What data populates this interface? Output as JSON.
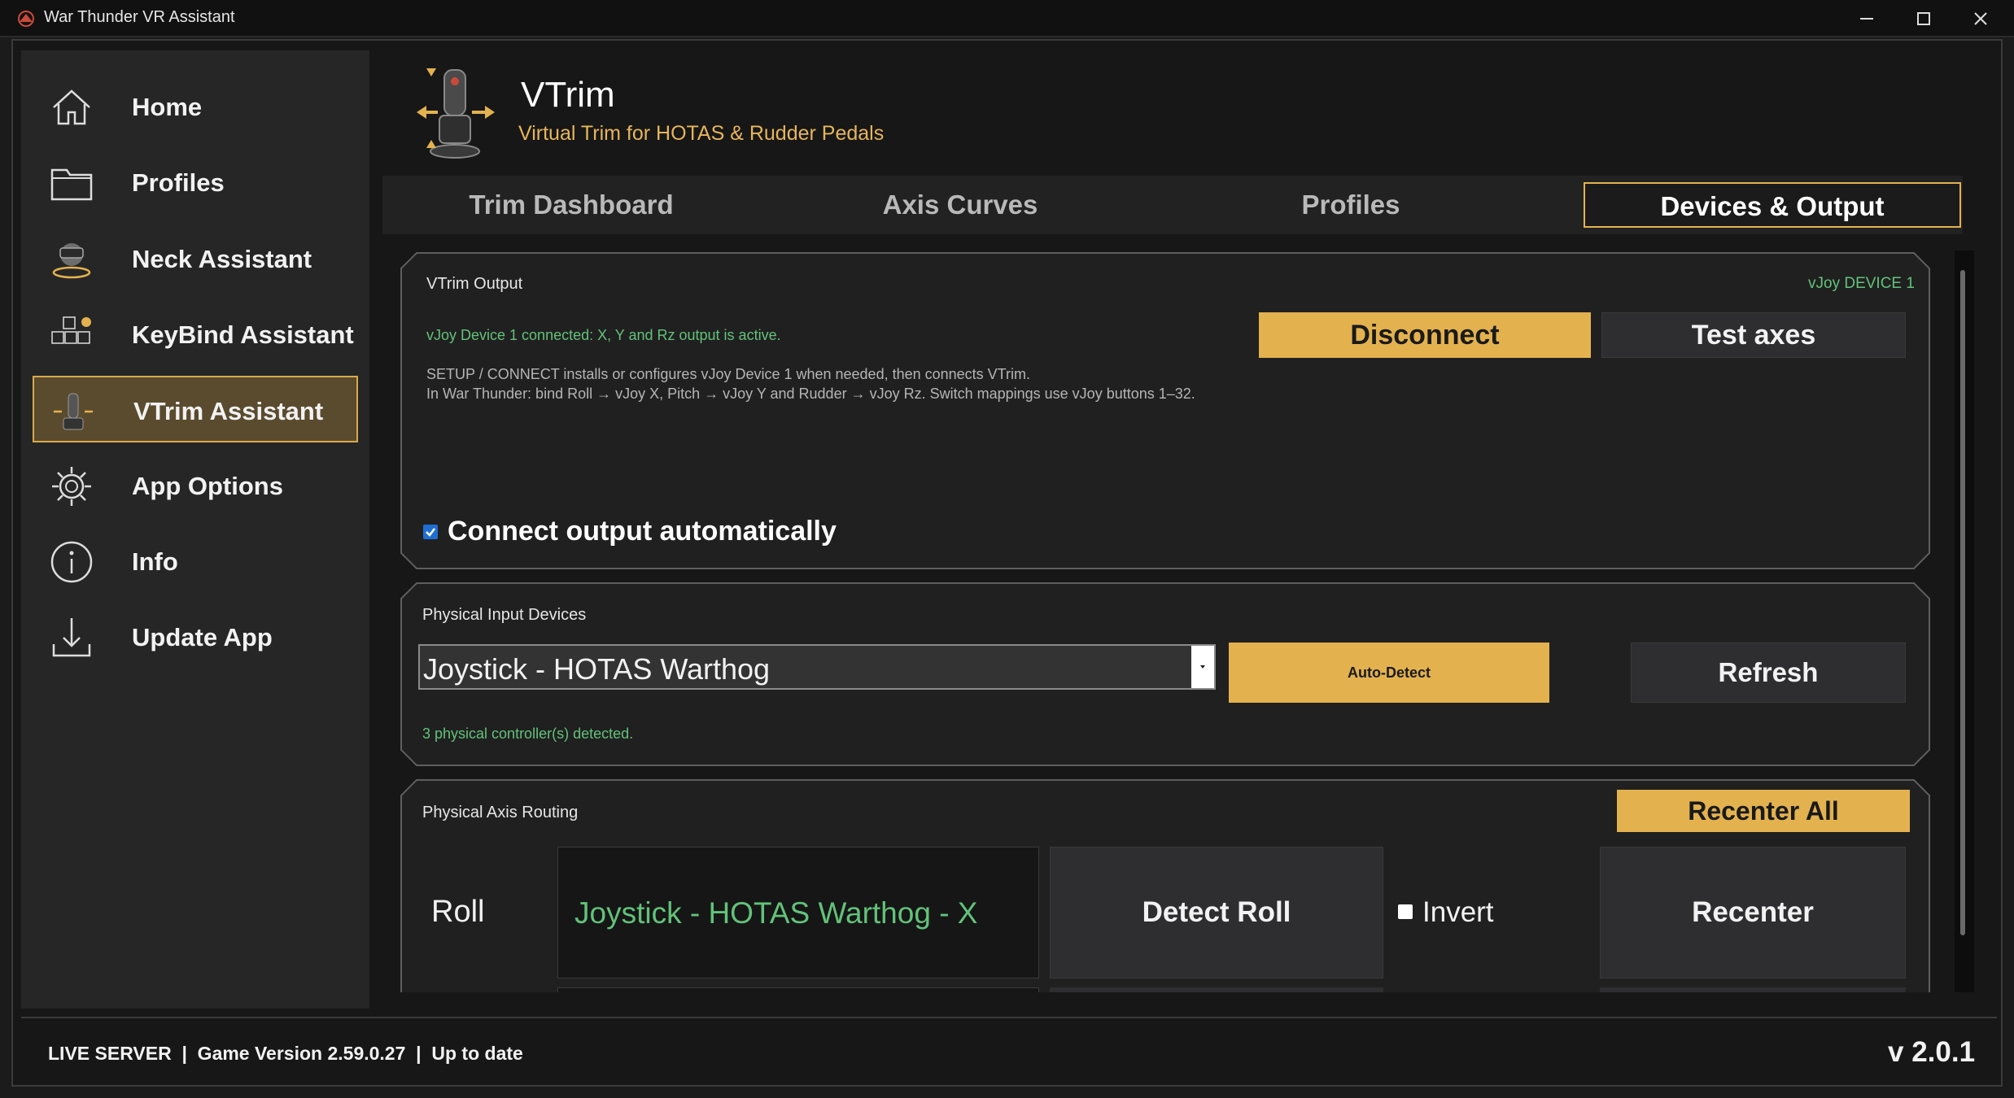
{
  "window": {
    "title": "War Thunder VR Assistant"
  },
  "sidebar": {
    "items": [
      {
        "label": "Home",
        "icon": "home-icon"
      },
      {
        "label": "Profiles",
        "icon": "folder-icon"
      },
      {
        "label": "Neck Assistant",
        "icon": "vr-headset-icon"
      },
      {
        "label": "KeyBind Assistant",
        "icon": "keyboard-icon"
      },
      {
        "label": "VTrim Assistant",
        "icon": "joystick-icon"
      },
      {
        "label": "App Options",
        "icon": "gear-icon"
      },
      {
        "label": "Info",
        "icon": "info-icon"
      },
      {
        "label": "Update App",
        "icon": "download-icon"
      }
    ],
    "active_index": 4
  },
  "header": {
    "title": "VTrim",
    "subtitle": "Virtual Trim for HOTAS & Rudder Pedals"
  },
  "tabs": [
    {
      "label": "Trim Dashboard"
    },
    {
      "label": "Axis Curves"
    },
    {
      "label": "Profiles"
    },
    {
      "label": "Devices & Output"
    }
  ],
  "active_tab": 3,
  "vtrim_output": {
    "title": "VTrim Output",
    "device_badge": "vJoy DEVICE 1",
    "status": "vJoy Device 1 connected: X, Y and Rz output is active.",
    "info_line1": "SETUP / CONNECT installs or configures vJoy Device 1 when needed, then connects VTrim.",
    "info_line2": "In War Thunder: bind Roll → vJoy X, Pitch → vJoy Y and Rudder → vJoy Rz. Switch mappings use vJoy buttons 1–32.",
    "disconnect_label": "Disconnect",
    "test_axes_label": "Test axes",
    "auto_connect_label": "Connect output automatically",
    "auto_connect_checked": true
  },
  "physical_input": {
    "title": "Physical Input Devices",
    "selected_device": "Joystick - HOTAS Warthog",
    "auto_detect_label": "Auto-Detect",
    "refresh_label": "Refresh",
    "status": "3 physical controller(s) detected."
  },
  "axis_routing": {
    "title": "Physical Axis Routing",
    "recenter_all_label": "Recenter All",
    "rows": [
      {
        "axis": "Roll",
        "source": "Joystick - HOTAS Warthog - X",
        "detect_label": "Detect Roll",
        "invert_label": "Invert",
        "invert_checked": false,
        "recenter_label": "Recenter"
      }
    ]
  },
  "footer": {
    "status": "LIVE SERVER  |  Game Version 2.59.0.27  |  Up to date",
    "version": "v 2.0.1"
  },
  "colors": {
    "accent": "#e3b24f",
    "active_nav_bg": "#5a4b2f",
    "ok_green": "#62c27a",
    "checkbox_blue": "#1f6fd1"
  }
}
